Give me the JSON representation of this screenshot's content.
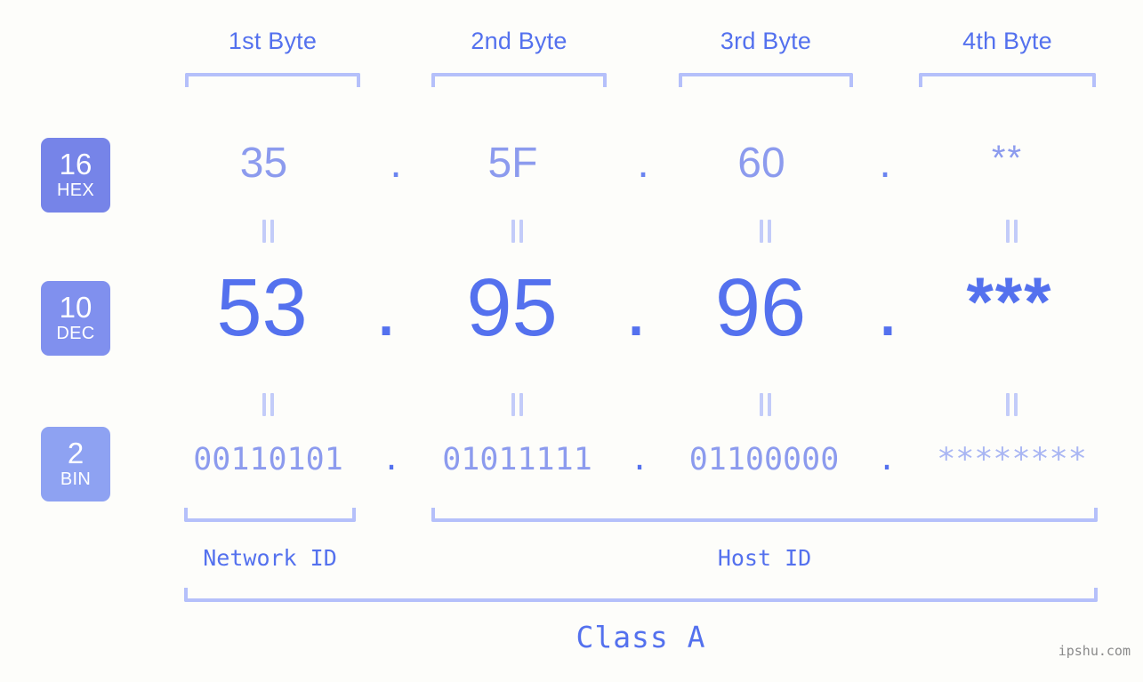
{
  "meta": {
    "background_color": "#fdfdfa",
    "accent_color": "#5471ee",
    "accent_light_color": "#8c9bee",
    "bracket_color": "#b5c0fa"
  },
  "byte_headers": [
    {
      "label": "1st Byte"
    },
    {
      "label": "2nd Byte"
    },
    {
      "label": "3rd Byte"
    },
    {
      "label": "4th Byte"
    }
  ],
  "bases": [
    {
      "number": "16",
      "abbr": "HEX",
      "color": "#7684e8"
    },
    {
      "number": "10",
      "abbr": "DEC",
      "color": "#8090ee"
    },
    {
      "number": "2",
      "abbr": "BIN",
      "color": "#8ea2f2"
    }
  ],
  "rows": {
    "hex": {
      "base_label": "16",
      "base_abbr": "HEX",
      "bytes": [
        "35",
        "5F",
        "60",
        "**"
      ],
      "separator": "."
    },
    "dec": {
      "base_label": "10",
      "base_abbr": "DEC",
      "bytes": [
        "53",
        "95",
        "96",
        "***"
      ],
      "separator": "."
    },
    "bin": {
      "base_label": "2",
      "base_abbr": "BIN",
      "bytes": [
        "00110101",
        "01011111",
        "01100000",
        "********"
      ],
      "separator": "."
    }
  },
  "id_sections": [
    {
      "label": "Network ID"
    },
    {
      "label": "Host ID"
    }
  ],
  "class": {
    "label": "Class A"
  },
  "watermark": {
    "text": "ipshu.com"
  }
}
